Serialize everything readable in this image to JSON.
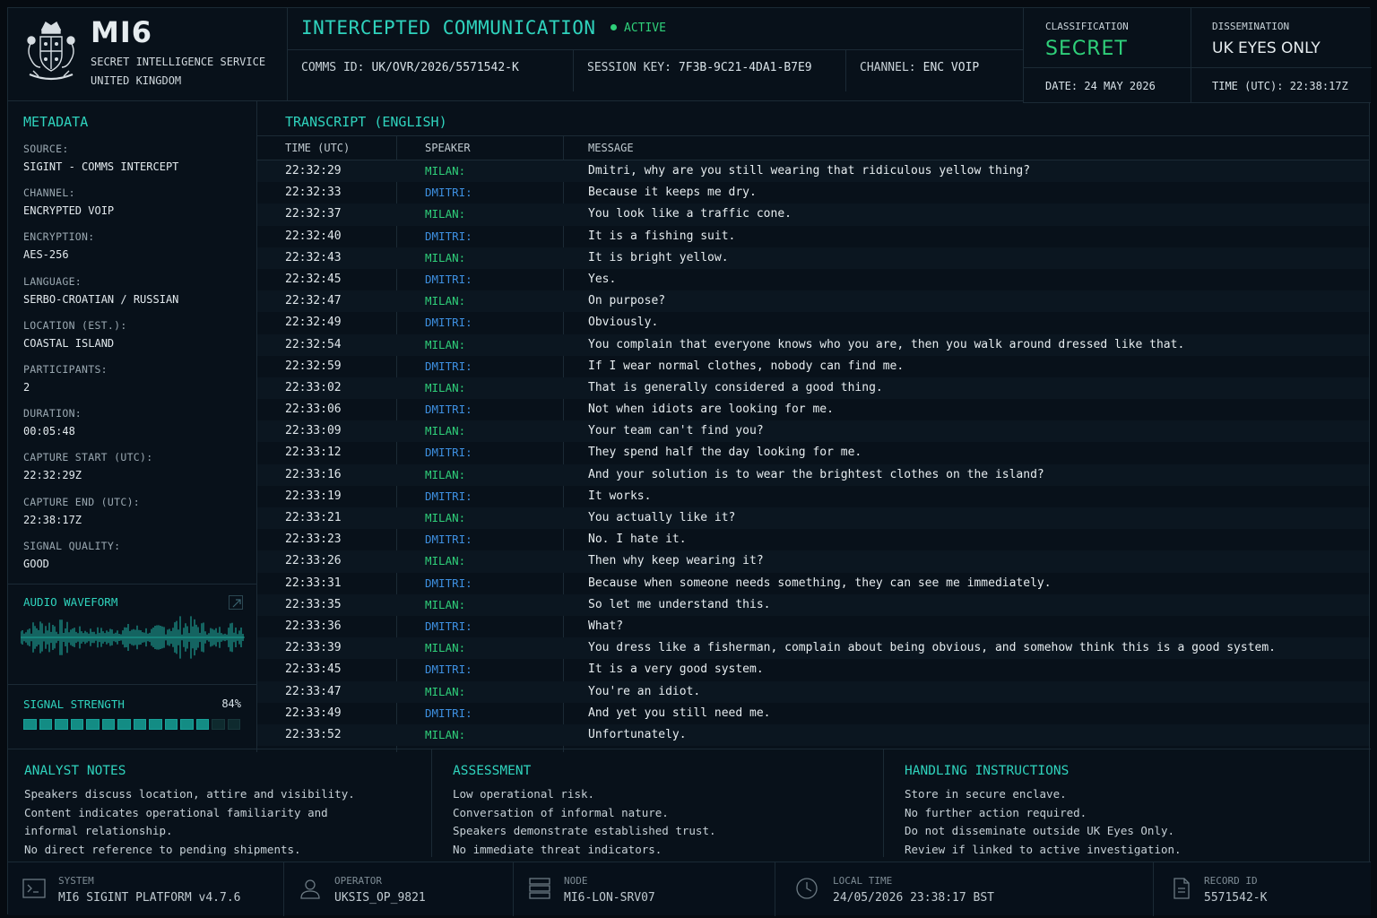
{
  "brand": {
    "title": "MI6",
    "sub1": "SECRET INTELLIGENCE SERVICE",
    "sub2": "UNITED KINGDOM"
  },
  "comm": {
    "title": "INTERCEPTED COMMUNICATION",
    "status": "ACTIVE",
    "comms_id_label": "COMMS ID:",
    "comms_id": "UK/OVR/2026/5571542-K",
    "session_key_label": "SESSION KEY:",
    "session_key": "7F3B-9C21-4DA1-B7E9",
    "channel_label": "CHANNEL:",
    "channel": "ENC VOIP"
  },
  "classification": {
    "label": "CLASSIFICATION",
    "value": "SECRET",
    "dissem_label": "DISSEMINATION",
    "dissem_value": "UK EYES ONLY",
    "date_label": "DATE:",
    "date": "24 MAY 2026",
    "time_label": "TIME (UTC):",
    "time": "22:38:17Z"
  },
  "metadata": {
    "title": "METADATA",
    "items": [
      {
        "k": "SOURCE:",
        "v": "SIGINT - COMMS INTERCEPT"
      },
      {
        "k": "CHANNEL:",
        "v": "ENCRYPTED VOIP"
      },
      {
        "k": "ENCRYPTION:",
        "v": "AES-256"
      },
      {
        "k": "LANGUAGE:",
        "v": "SERBO-CROATIAN / RUSSIAN"
      },
      {
        "k": "LOCATION (EST.):",
        "v": "COASTAL ISLAND"
      },
      {
        "k": "PARTICIPANTS:",
        "v": "2"
      },
      {
        "k": "DURATION:",
        "v": "00:05:48"
      },
      {
        "k": "CAPTURE START (UTC):",
        "v": "22:32:29Z"
      },
      {
        "k": "CAPTURE END (UTC):",
        "v": "22:38:17Z"
      },
      {
        "k": "SIGNAL QUALITY:",
        "v": "GOOD"
      }
    ]
  },
  "waveform": {
    "title": "AUDIO WAVEFORM"
  },
  "signal": {
    "title": "SIGNAL STRENGTH",
    "percent_label": "84%",
    "level": 0.84,
    "segments": 14
  },
  "transcript": {
    "title": "TRANSCRIPT (ENGLISH)",
    "headers": {
      "time": "TIME (UTC)",
      "speaker": "SPEAKER",
      "message": "MESSAGE"
    },
    "rows": [
      {
        "t": "22:32:29",
        "s": "MILAN:",
        "m": "Dmitri, why are you still wearing that ridiculous yellow thing?"
      },
      {
        "t": "22:32:33",
        "s": "DMITRI:",
        "m": "Because it keeps me dry."
      },
      {
        "t": "22:32:37",
        "s": "MILAN:",
        "m": "You look like a traffic cone."
      },
      {
        "t": "22:32:40",
        "s": "DMITRI:",
        "m": "It is a fishing suit."
      },
      {
        "t": "22:32:43",
        "s": "MILAN:",
        "m": "It is bright yellow."
      },
      {
        "t": "22:32:45",
        "s": "DMITRI:",
        "m": "Yes."
      },
      {
        "t": "22:32:47",
        "s": "MILAN:",
        "m": "On purpose?"
      },
      {
        "t": "22:32:49",
        "s": "DMITRI:",
        "m": "Obviously."
      },
      {
        "t": "22:32:54",
        "s": "MILAN:",
        "m": "You complain that everyone knows who you are, then you walk around dressed like that."
      },
      {
        "t": "22:32:59",
        "s": "DMITRI:",
        "m": "If I wear normal clothes, nobody can find me."
      },
      {
        "t": "22:33:02",
        "s": "MILAN:",
        "m": "That is generally considered a good thing."
      },
      {
        "t": "22:33:06",
        "s": "DMITRI:",
        "m": "Not when idiots are looking for me."
      },
      {
        "t": "22:33:09",
        "s": "MILAN:",
        "m": "Your team can't find you?"
      },
      {
        "t": "22:33:12",
        "s": "DMITRI:",
        "m": "They spend half the day looking for me."
      },
      {
        "t": "22:33:16",
        "s": "MILAN:",
        "m": "And your solution is to wear the brightest clothes on the island?"
      },
      {
        "t": "22:33:19",
        "s": "DMITRI:",
        "m": "It works."
      },
      {
        "t": "22:33:21",
        "s": "MILAN:",
        "m": "You actually like it?"
      },
      {
        "t": "22:33:23",
        "s": "DMITRI:",
        "m": "No. I hate it."
      },
      {
        "t": "22:33:26",
        "s": "MILAN:",
        "m": "Then why keep wearing it?"
      },
      {
        "t": "22:33:31",
        "s": "DMITRI:",
        "m": "Because when someone needs something, they can see me immediately."
      },
      {
        "t": "22:33:35",
        "s": "MILAN:",
        "m": "So let me understand this."
      },
      {
        "t": "22:33:36",
        "s": "DMITRI:",
        "m": "What?"
      },
      {
        "t": "22:33:39",
        "s": "MILAN:",
        "m": "You dress like a fisherman, complain about being obvious, and somehow think this is a good system."
      },
      {
        "t": "22:33:45",
        "s": "DMITRI:",
        "m": "It is a very good system."
      },
      {
        "t": "22:33:47",
        "s": "MILAN:",
        "m": "You're an idiot."
      },
      {
        "t": "22:33:49",
        "s": "DMITRI:",
        "m": "And yet you still need me."
      },
      {
        "t": "22:33:52",
        "s": "MILAN:",
        "m": "Unfortunately."
      }
    ]
  },
  "notes": {
    "analyst": {
      "title": "ANALYST NOTES",
      "lines": [
        "Speakers discuss location, attire and visibility.",
        "Content indicates operational familiarity and",
        "informal relationship.",
        "No direct reference to pending shipments."
      ]
    },
    "assessment": {
      "title": "ASSESSMENT",
      "lines": [
        "Low operational risk.",
        "Conversation of informal nature.",
        "Speakers demonstrate established trust.",
        "No immediate threat indicators."
      ]
    },
    "handling": {
      "title": "HANDLING INSTRUCTIONS",
      "lines": [
        "Store in secure enclave.",
        "No further action required.",
        "Do not disseminate outside UK Eyes Only.",
        "Review if linked to active investigation."
      ]
    }
  },
  "footer": {
    "system_label": "SYSTEM",
    "system": "MI6 SIGINT PLATFORM v4.7.6",
    "operator_label": "OPERATOR",
    "operator": "UKSIS_OP_9821",
    "node_label": "NODE",
    "node": "MI6-LON-SRV07",
    "time_label": "LOCAL TIME",
    "time": "24/05/2026 23:38:17 BST",
    "record_label": "RECORD ID",
    "record": "5571542-K"
  },
  "colors": {
    "accent": "#2fd3bd",
    "milan": "#2fd07a",
    "dmitri": "#3d8fe0",
    "secret": "#2fd07a"
  },
  "icons": {
    "crest": "royal-crest-icon",
    "terminal": "terminal-icon",
    "operator": "user-icon",
    "node": "server-icon",
    "clock": "clock-icon",
    "record": "document-icon",
    "expand": "expand-icon"
  }
}
